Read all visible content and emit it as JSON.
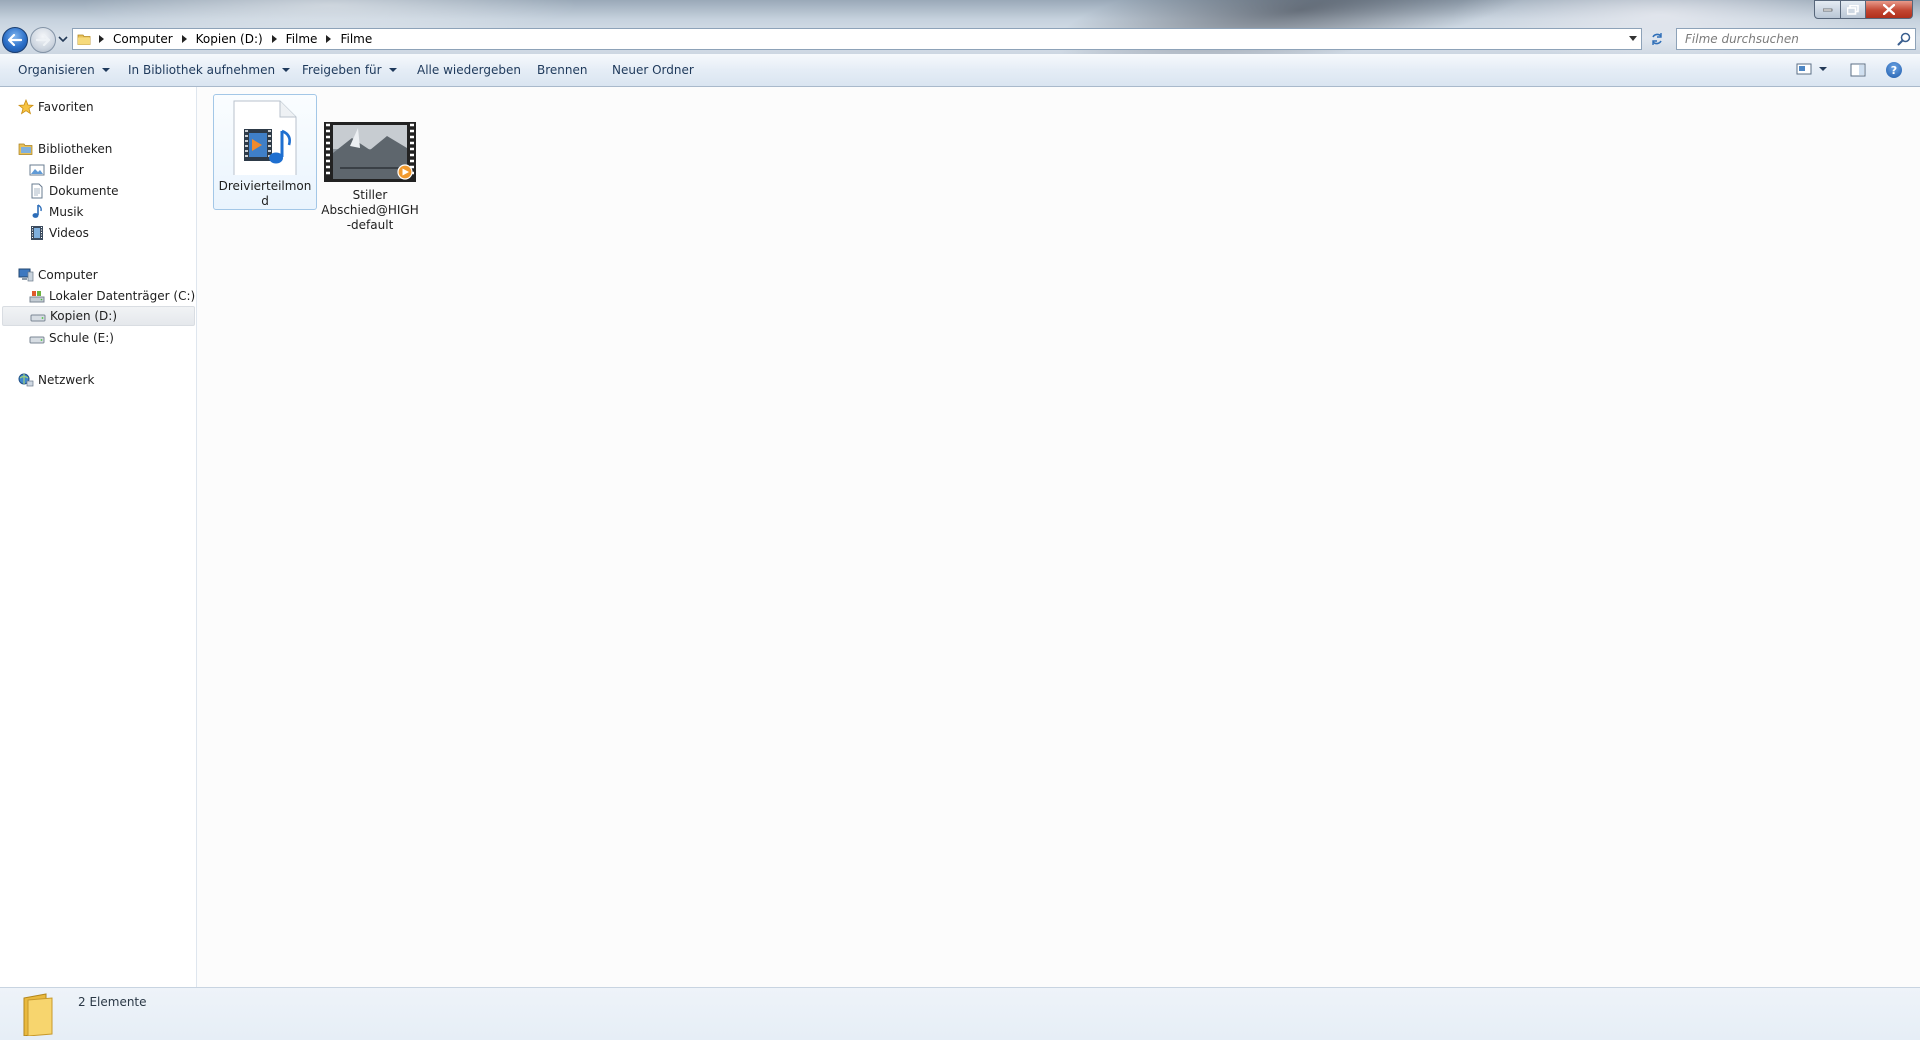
{
  "address": {
    "crumbs": [
      "Computer",
      "Kopien (D:)",
      "Filme",
      "Filme"
    ]
  },
  "search": {
    "placeholder": "Filme durchsuchen"
  },
  "toolbar": {
    "organize": "Organisieren",
    "include_library": "In Bibliothek aufnehmen",
    "share_with": "Freigeben für",
    "play_all": "Alle wiedergeben",
    "burn": "Brennen",
    "new_folder": "Neuer Ordner"
  },
  "sidebar": {
    "favorites": "Favoriten",
    "libraries": {
      "label": "Bibliotheken",
      "items": [
        "Bilder",
        "Dokumente",
        "Musik",
        "Videos"
      ]
    },
    "computer": {
      "label": "Computer",
      "drives": [
        "Lokaler Datenträger (C:)",
        "Kopien (D:)",
        "Schule (E:)"
      ],
      "selected": "Kopien (D:)"
    },
    "network": "Netzwerk"
  },
  "files": [
    {
      "name": "Dreivierteilmond",
      "icon": "media-file-icon",
      "selected": true
    },
    {
      "name": "Stiller Abschied@HIGH-default",
      "icon": "video-thumbnail-icon",
      "selected": false
    }
  ],
  "details": {
    "count": "2 Elemente"
  }
}
